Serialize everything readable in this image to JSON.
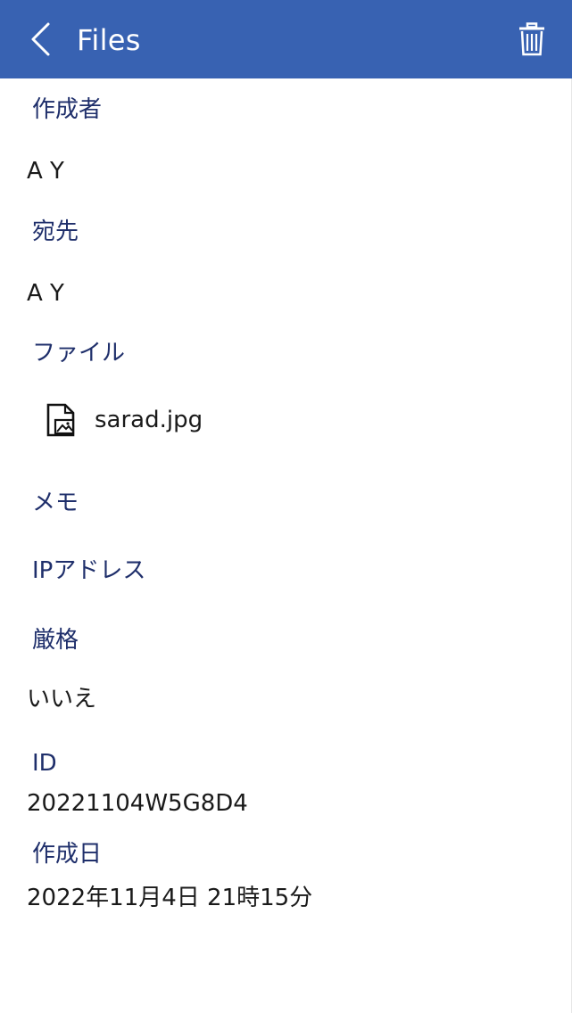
{
  "header": {
    "title": "Files",
    "back_icon": "chevron-left-icon",
    "delete_icon": "trash-icon",
    "background_color": "#3862b2"
  },
  "fields": {
    "author": {
      "label": "作成者",
      "value": "A Y"
    },
    "recipient": {
      "label": "宛先",
      "value": "A Y"
    },
    "file": {
      "label": "ファイル",
      "name": "sarad.jpg",
      "icon": "image-file-icon"
    },
    "memo": {
      "label": "メモ"
    },
    "ip_address": {
      "label": "IPアドレス"
    },
    "strict": {
      "label": "厳格",
      "value": "いいえ"
    },
    "id": {
      "label": "ID",
      "value": "20221104W5G8D4"
    },
    "created": {
      "label": "作成日",
      "value": "2022年11月4日 21時15分"
    }
  }
}
